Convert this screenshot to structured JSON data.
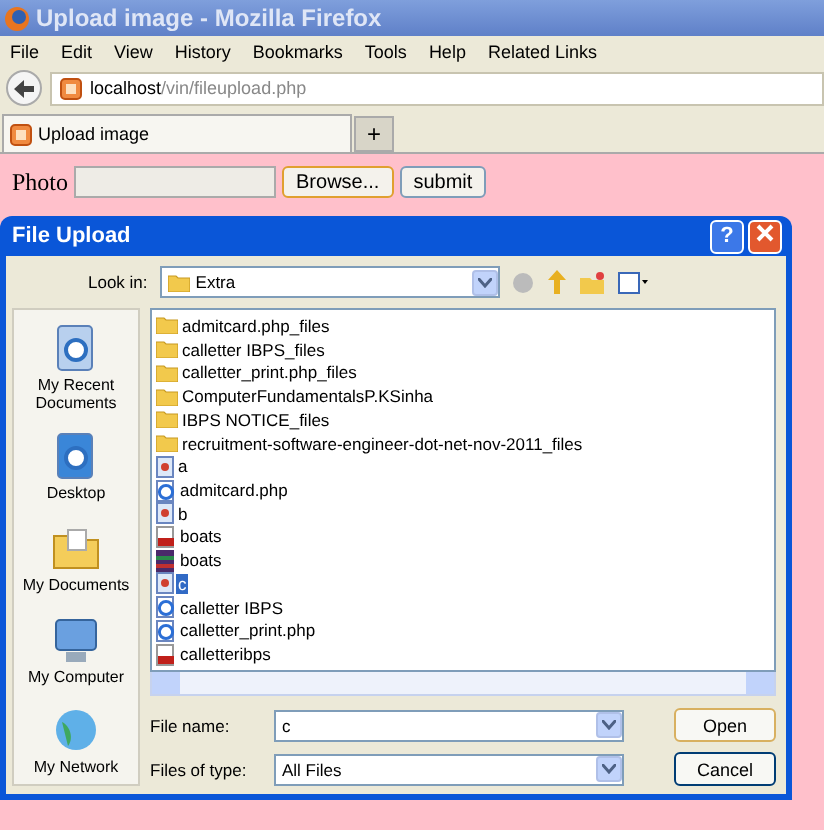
{
  "window": {
    "title": "Upload image - Mozilla Firefox"
  },
  "menu": [
    "File",
    "Edit",
    "View",
    "History",
    "Bookmarks",
    "Tools",
    "Help",
    "Related Links"
  ],
  "address": {
    "host": "localhost",
    "path": "/vin/fileupload.php"
  },
  "tabs": [
    {
      "label": "Upload image",
      "selected": true
    }
  ],
  "new_tab": "+",
  "form": {
    "label": "Photo",
    "browse": "Browse...",
    "submit": "submit"
  },
  "dialog": {
    "title": "File Upload",
    "help": "?",
    "look_in_label": "Look in:",
    "look_in": "Extra",
    "places": [
      "My Recent Documents",
      "Desktop",
      "My Documents",
      "My Computer",
      "My Network"
    ],
    "files": [
      {
        "name": "admitcard.php_files",
        "kind": "folder",
        "selected": false
      },
      {
        "name": "calletter IBPS_files",
        "kind": "folder",
        "selected": false
      },
      {
        "name": "calletter_print.php_files",
        "kind": "folder",
        "selected": false
      },
      {
        "name": "ComputerFundamentalsP.KSinha",
        "kind": "folder",
        "selected": false
      },
      {
        "name": "IBPS NOTICE_files",
        "kind": "folder",
        "selected": false
      },
      {
        "name": "recruitment-software-engineer-dot-net-nov-2011_files",
        "kind": "folder",
        "selected": false
      },
      {
        "name": "a",
        "kind": "image",
        "selected": false
      },
      {
        "name": "admitcard.php",
        "kind": "web",
        "selected": false
      },
      {
        "name": "b",
        "kind": "image",
        "selected": false
      },
      {
        "name": "boats",
        "kind": "pdf",
        "selected": false
      },
      {
        "name": "boats",
        "kind": "archive",
        "selected": false
      },
      {
        "name": "c",
        "kind": "image",
        "selected": true
      },
      {
        "name": "calletter IBPS",
        "kind": "web",
        "selected": false
      },
      {
        "name": "calletter_print.php",
        "kind": "web",
        "selected": false
      },
      {
        "name": "calletteribps",
        "kind": "pdf",
        "selected": false
      }
    ],
    "file_name_label": "File name:",
    "file_name": "c",
    "type_label": "Files of type:",
    "type": "All Files",
    "open": "Open",
    "cancel": "Cancel"
  }
}
